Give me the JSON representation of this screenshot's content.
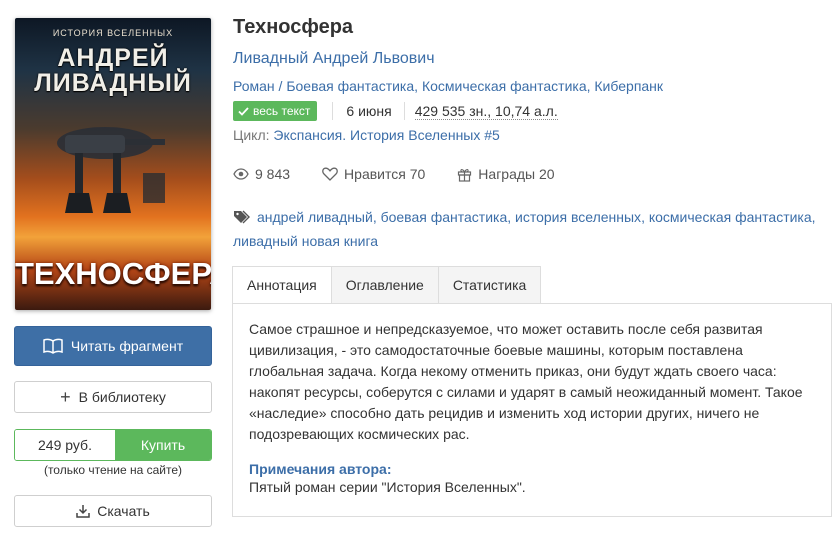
{
  "cover": {
    "series": "ИСТОРИЯ ВСЕЛЕННЫХ",
    "author_line1": "АНДРЕЙ",
    "author_line2": "ЛИВАДНЫЙ",
    "title": "ТЕХНОСФЕРА"
  },
  "actions": {
    "read_fragment": "Читать фрагмент",
    "read_icon": "book-icon",
    "add_library": "В библиотеку",
    "price": "249 руб.",
    "buy": "Купить",
    "buy_note": "(только чтение на сайте)",
    "download": "Скачать",
    "download_icon": "download-icon"
  },
  "book": {
    "title": "Техносфера",
    "author": "Ливадный Андрей Львович",
    "genres": [
      "Роман",
      "Боевая фантастика",
      "Космическая фантастика",
      "Киберпанк"
    ],
    "status_badge": "весь текст",
    "date": "6 июня",
    "size": "429 535 зн., 10,74 а.л.",
    "cycle_label": "Цикл:",
    "cycle": "Экспансия. История Вселенных #5"
  },
  "stats": {
    "views": "9 843",
    "likes_label": "Нравится",
    "likes": "70",
    "awards_label": "Награды",
    "awards": "20"
  },
  "tags": [
    "андрей ливадный",
    "боевая фантастика",
    "история вселенных",
    "космическая фантастика",
    "ливадный новая книга"
  ],
  "tabs": [
    "Аннотация",
    "Оглавление",
    "Статистика"
  ],
  "annotation": "Самое страшное и непредсказуемое, что может оставить после себя развитая цивилизация, - это самодостаточные боевые машины, которым поставлена глобальная задача. Когда некому отменить приказ, они будут ждать своего часа: накопят ресурсы, соберутся с силами и ударят в самый неожиданный момент. Такое «наследие» способно дать рецидив и изменить ход истории других, ничего не подозревающих космических рас.",
  "author_notes": {
    "heading": "Примечания автора:",
    "text": "Пятый роман серии \"История Вселенных\"."
  },
  "colors": {
    "link": "#3c6ea8",
    "primary_button": "#3e6fa6",
    "buy_green": "#5cb85c"
  }
}
